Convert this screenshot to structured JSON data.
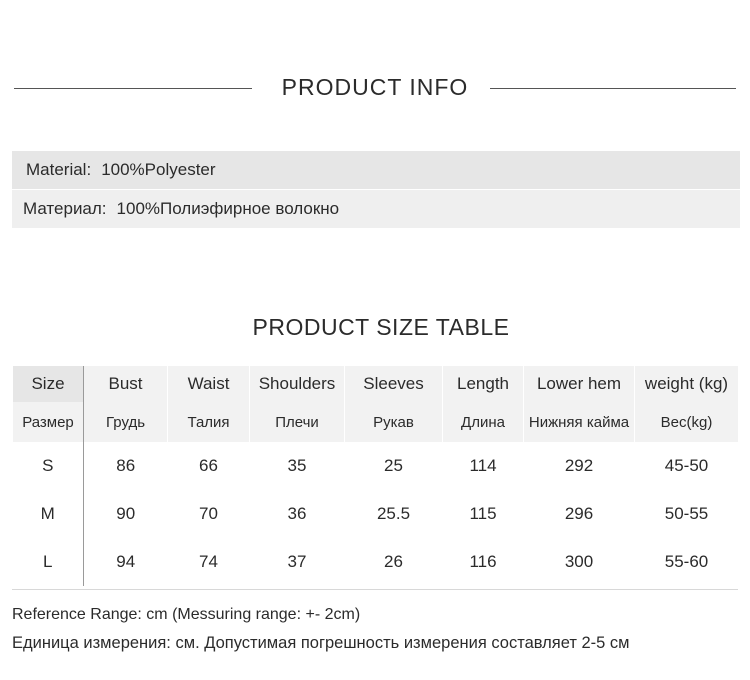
{
  "product_info": {
    "title": "PRODUCT INFO",
    "material_en": {
      "label": "Material:",
      "value": "100%Polyester"
    },
    "material_ru": {
      "label": "Материал:",
      "value": "100%Полиэфирное волокно"
    }
  },
  "size_table": {
    "title": "PRODUCT SIZE TABLE",
    "headers_en": [
      "Size",
      "Bust",
      "Waist",
      "Shoulders",
      "Sleeves",
      "Length",
      "Lower hem",
      "weight (kg)"
    ],
    "headers_ru": [
      "Размер",
      "Грудь",
      "Талия",
      "Плечи",
      "Рукав",
      "Длина",
      "Нижняя кайма",
      "Вес(kg)"
    ],
    "rows": [
      [
        "S",
        "86",
        "66",
        "35",
        "25",
        "114",
        "292",
        "45-50"
      ],
      [
        "M",
        "90",
        "70",
        "36",
        "25.5",
        "115",
        "296",
        "50-55"
      ],
      [
        "L",
        "94",
        "74",
        "37",
        "26",
        "116",
        "300",
        "55-60"
      ]
    ]
  },
  "notes": {
    "reference_en": "Reference Range: cm (Messuring range: +- 2cm)",
    "reference_ru": "Единица измерения: см. Допустимая погрешность измерения составляет 2-5 см"
  }
}
